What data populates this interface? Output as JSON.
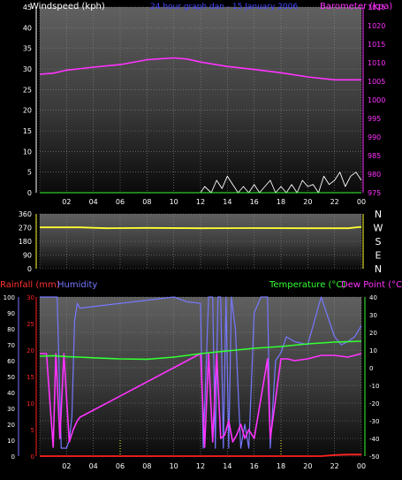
{
  "header": {
    "windspeed_label": "Windspeed (kph)",
    "period_label": "24 hour graph dan - 15 January 2006",
    "barometer_label": "Barometer (kpa)"
  },
  "labels": {
    "rainfall": "Rainfall (mm)",
    "humidity": "Humidity",
    "temperature": "Temperature (°C)",
    "dewpoint": "Dew Point (°C)"
  },
  "colors": {
    "windspeed": "#ffffff",
    "barometer": "#ff33ff",
    "direction": "#ffff33",
    "rainfall": "#ff2222",
    "humidity": "#7777ff",
    "temperature": "#33ff33",
    "dewpoint": "#ff33ff"
  },
  "x_ticks": [
    "02",
    "04",
    "06",
    "08",
    "10",
    "12",
    "14",
    "16",
    "18",
    "20",
    "22",
    "00"
  ],
  "chart_data": [
    {
      "type": "line",
      "title": "24 hour graph dan - 15 January 2006",
      "xlabel": "",
      "ylabel": "Windspeed (kph)",
      "ylabel_right": "Barometer (kpa)",
      "ylim": [
        0,
        45
      ],
      "ylim_right": [
        975,
        1025
      ],
      "yticks": [
        0,
        5,
        10,
        15,
        20,
        25,
        30,
        35,
        40,
        45
      ],
      "yticks_right": [
        975,
        980,
        985,
        990,
        995,
        1000,
        1005,
        1010,
        1015,
        1020,
        1025
      ],
      "xlim_hours": [
        0,
        24
      ],
      "barometer": {
        "name": "Barometer (kpa)",
        "x": [
          0,
          1,
          2,
          4,
          6,
          8,
          10,
          11,
          12,
          14,
          16,
          18,
          20,
          22,
          24
        ],
        "y": [
          1006.9,
          1007.2,
          1008.0,
          1008.8,
          1009.5,
          1010.8,
          1011.3,
          1011.0,
          1010.2,
          1009.0,
          1008.2,
          1007.3,
          1006.2,
          1005.4,
          1005.4
        ]
      },
      "windspeed": {
        "name": "Windspeed (kph)",
        "x": [
          0,
          5,
          10,
          12,
          12.3,
          12.8,
          13.2,
          13.6,
          14,
          14.4,
          14.8,
          15.2,
          15.6,
          16,
          16.4,
          16.8,
          17.2,
          17.6,
          18,
          18.4,
          18.8,
          19.2,
          19.6,
          20,
          20.4,
          20.8,
          21.2,
          21.6,
          22,
          22.4,
          22.8,
          23.2,
          23.6,
          24
        ],
        "y": [
          0,
          0,
          0,
          0,
          1.5,
          0,
          3,
          1,
          4,
          2,
          0,
          1.5,
          0,
          2,
          0,
          1.5,
          3,
          0,
          1.5,
          0,
          2,
          0,
          3,
          1.5,
          2,
          0,
          4,
          2,
          3,
          5,
          1.5,
          4,
          5,
          3
        ]
      },
      "grid": true
    },
    {
      "type": "line",
      "title": "",
      "ylabel": "",
      "ylim": [
        0,
        360
      ],
      "yticks": [
        0,
        90,
        180,
        270,
        360
      ],
      "compass_labels": [
        "N",
        "W",
        "S",
        "E",
        "N"
      ],
      "xlim_hours": [
        0,
        24
      ],
      "direction": {
        "name": "",
        "x": [
          0,
          3,
          5,
          8,
          12,
          16,
          20,
          23,
          24
        ],
        "y": [
          272,
          272,
          266,
          268,
          266,
          267,
          266,
          266,
          275
        ]
      },
      "grid": true
    },
    {
      "type": "line",
      "title": "",
      "ylabel_left_outer": "Rainfall (mm)",
      "ylabel_left_inner": "Humidity",
      "ylabel_right": "Temperature (°C)",
      "ylabel_right_2": "Dew Point (°C)",
      "ylim_rain": [
        0,
        30
      ],
      "yticks_rain": [
        0,
        5,
        10,
        15,
        20,
        25,
        30
      ],
      "ylim_humidity": [
        0,
        100
      ],
      "yticks_humidity": [
        0,
        10,
        20,
        30,
        40,
        50,
        60,
        70,
        80,
        90,
        100
      ],
      "ylim_temp": [
        -50,
        40
      ],
      "yticks_temp": [
        -50,
        -40,
        -30,
        -20,
        -10,
        0,
        10,
        20,
        30,
        40
      ],
      "xlim_hours": [
        0,
        24
      ],
      "humidity": {
        "name": "Humidity",
        "x": [
          0,
          0.3,
          0.5,
          0.7,
          0.9,
          1.1,
          1.3,
          1.6,
          1.9,
          2.0,
          2.2,
          2.4,
          2.6,
          2.8,
          3.0,
          5,
          8,
          10,
          11,
          12,
          12.2,
          12.6,
          12.9,
          13.1,
          13.3,
          13.5,
          13.7,
          13.9,
          14.1,
          14.3,
          14.6,
          15,
          15.3,
          15.6,
          16,
          16.5,
          17,
          17.2,
          17.6,
          18,
          18.4,
          19,
          20,
          20.5,
          21,
          21.4,
          22,
          22.5,
          23,
          23.5,
          24
        ],
        "y": [
          100,
          100,
          100,
          100,
          100,
          100,
          100,
          5,
          5,
          5,
          10,
          25,
          85,
          96,
          93,
          95,
          98,
          100,
          97,
          96,
          5,
          100,
          100,
          5,
          100,
          100,
          5,
          100,
          5,
          100,
          80,
          5,
          20,
          5,
          90,
          100,
          100,
          5,
          60,
          65,
          75,
          72,
          70,
          85,
          100,
          90,
          75,
          70,
          72,
          75,
          82
        ]
      },
      "temperature": {
        "name": "Temperature (°C)",
        "x": [
          0,
          1,
          2,
          3,
          4,
          6,
          8,
          10,
          12,
          14,
          16,
          18,
          20,
          22,
          24
        ],
        "y": [
          6.5,
          6.8,
          6.3,
          6.0,
          5.6,
          5.0,
          4.8,
          6.0,
          8.0,
          9.5,
          11.0,
          12.0,
          13.5,
          14.5,
          15.0
        ]
      },
      "dewpoint": {
        "name": "Dew Point (°C)",
        "x": [
          0,
          0.5,
          1,
          1.2,
          1.5,
          1.8,
          2.2,
          2.5,
          2.8,
          3.0,
          12,
          12.3,
          12.6,
          12.9,
          13.2,
          13.5,
          13.8,
          14.1,
          14.4,
          14.7,
          15,
          15.3,
          15.6,
          16,
          17,
          17.2,
          18,
          18.5,
          19,
          20,
          21,
          22,
          23,
          24
        ],
        "y": [
          8,
          8,
          -45,
          8,
          -40,
          8,
          -42,
          -35,
          -30,
          -28,
          8,
          -45,
          8,
          -42,
          8,
          -40,
          -38,
          -30,
          -42,
          -38,
          -32,
          -40,
          -35,
          -40,
          5,
          -40,
          5,
          5,
          4,
          5,
          7,
          7,
          6,
          8
        ]
      },
      "rainfall": {
        "name": "Rainfall (mm)",
        "x": [
          0,
          21,
          22,
          23,
          24
        ],
        "y": [
          0,
          0,
          0.2,
          0.3,
          0.3
        ]
      },
      "grid": true
    }
  ]
}
